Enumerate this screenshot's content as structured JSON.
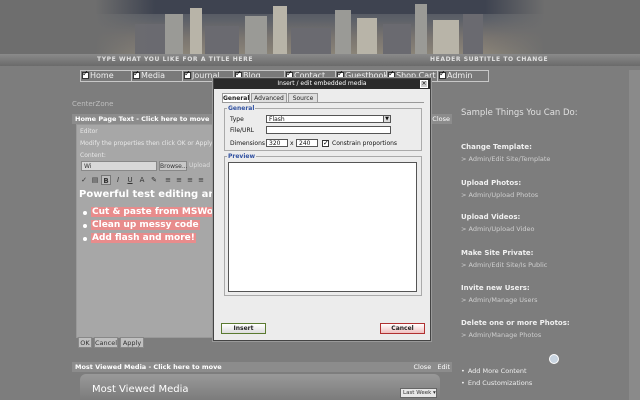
{
  "header": {
    "title": "TYPE WHAT YOU LIKE FOR A TITLE HERE",
    "subtitle": "HEADER SUBTITLE TO CHANGE"
  },
  "nav": [
    {
      "label": "Home",
      "checked": true
    },
    {
      "label": "Media",
      "checked": true
    },
    {
      "label": "Journal",
      "checked": true
    },
    {
      "label": "Blog",
      "checked": true
    },
    {
      "label": "Contact",
      "checked": true
    },
    {
      "label": "Guestbook",
      "checked": true
    },
    {
      "label": "Shop Cart",
      "checked": true
    },
    {
      "label": "Admin",
      "checked": true
    }
  ],
  "center_zone": "CenterZone",
  "home_panel": {
    "title": "Home Page Text - Click here to move",
    "close": "Close",
    "editor_label": "Editor",
    "instructions": "Modify the properties then click OK or Apply to apply changes",
    "content_label": "Content:",
    "url_value": "Wi",
    "browse": "Browse...",
    "upload": "Upload",
    "bold_line": "Powerful test editing ans pell checker",
    "bullets": [
      "Cut & paste from MSWord",
      "Clean up messy code",
      "Add flash and more!"
    ],
    "buttons": {
      "ok": "OK",
      "cancel": "Cancel",
      "apply": "Apply"
    }
  },
  "toolbar_icons": [
    "spellcheck-icon",
    "paste-icon",
    "bold-icon",
    "italic-icon",
    "underline-icon",
    "text-color-icon",
    "highlight-icon",
    "align-left-icon",
    "align-center-icon",
    "align-right-icon",
    "justify-icon"
  ],
  "most_viewed": {
    "bar_title": "Most Viewed Media - Click here to move",
    "close": "Close",
    "edit": "Edit",
    "heading": "Most Viewed Media",
    "period": "Last Week"
  },
  "sidebar": {
    "heading": "Sample Things You Can Do:",
    "sections": [
      {
        "title": "Change Template:",
        "link": "> Admin/Edit Site/Template"
      },
      {
        "title": "Upload Photos:",
        "link": "> Admin/Upload Photos"
      },
      {
        "title": "Upload Videos:",
        "link": "> Admin/Upload Video"
      },
      {
        "title": "Make Site Private:",
        "link": "> Admin/Edit Site/Is Public"
      },
      {
        "title": "Invite new Users:",
        "link": "> Admin/Manage Users"
      },
      {
        "title": "Delete one or more Photos:",
        "link": "> Admin/Manage Photos"
      }
    ],
    "footer": [
      "Add More Content",
      "End Customizations"
    ]
  },
  "dialog": {
    "title": "Insert / edit embedded media",
    "tabs": [
      "General",
      "Advanced",
      "Source"
    ],
    "general_legend": "General",
    "type_label": "Type",
    "type_value": "Flash",
    "file_label": "File/URL",
    "file_value": "",
    "dimensions_label": "Dimensions",
    "width": "320",
    "height": "240",
    "times": "x",
    "constrain_label": "Constrain proportions",
    "constrain_checked": true,
    "preview_legend": "Preview",
    "insert": "Insert",
    "cancel": "Cancel"
  },
  "colors": {
    "page_bg": "#7d7d7d",
    "dialog_bg": "#ececec",
    "legend_blue": "#3050a0",
    "highlight_pink": "#e88c8c"
  }
}
